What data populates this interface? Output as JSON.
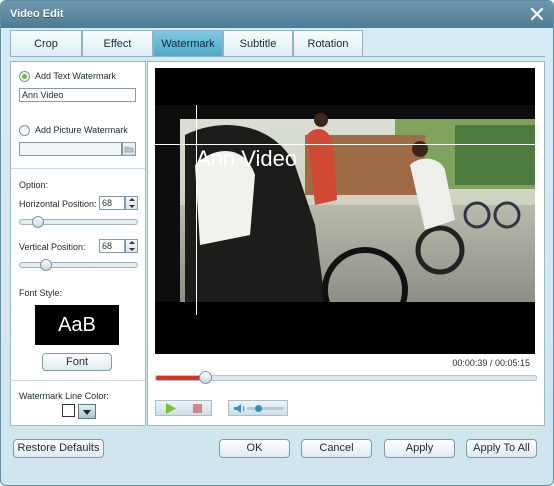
{
  "window": {
    "title": "Video Edit"
  },
  "tabs": [
    {
      "label": "Crop"
    },
    {
      "label": "Effect"
    },
    {
      "label": "Watermark",
      "active": true
    },
    {
      "label": "Subtitle"
    },
    {
      "label": "Rotation"
    }
  ],
  "watermark": {
    "text_option_label": "Add Text Watermark",
    "text_value": "Ann Video",
    "picture_option_label": "Add Picture Watermark",
    "picture_path": "",
    "option_heading": "Option:",
    "horizontal_label": "Horizontal Position:",
    "horizontal_value": "68",
    "vertical_label": "Vertical Position:",
    "vertical_value": "68",
    "font_style_label": "Font Style:",
    "font_preview": "AaB",
    "font_button": "Font",
    "line_color_label": "Watermark Line Color:",
    "line_color": "#ffffff",
    "selected_option": "text"
  },
  "preview": {
    "overlay_text": "Ann Video",
    "current_time": "00:00:39",
    "separator": "/",
    "total_time": "00:05:15",
    "seek_progress": 0.13,
    "volume": 0.3
  },
  "footer": {
    "restore_defaults": "Restore Defaults",
    "ok": "OK",
    "cancel": "Cancel",
    "apply": "Apply",
    "apply_to_all": "Apply To All"
  },
  "colors": {
    "accent_tab": "#5ab2d3",
    "seek_fill": "#d8321e",
    "play_icon": "#7cc12a"
  }
}
